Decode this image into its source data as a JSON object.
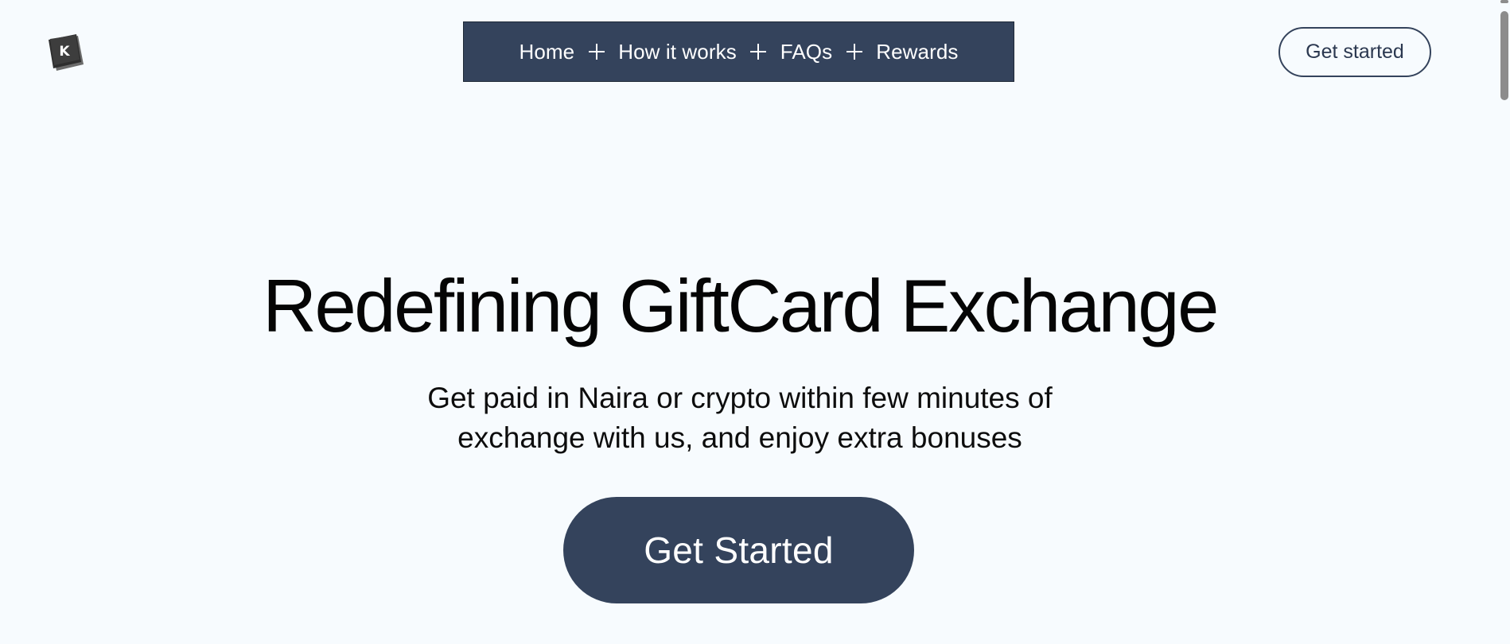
{
  "brand": {
    "logo_letter": "K",
    "logo_color": "#3a3a3a"
  },
  "nav": {
    "items": [
      {
        "label": "Home"
      },
      {
        "label": "How it works"
      },
      {
        "label": "FAQs"
      },
      {
        "label": "Rewards"
      }
    ],
    "separator_icon": "plus-icon",
    "background": "#34435c"
  },
  "header": {
    "cta_label": "Get started"
  },
  "hero": {
    "title": "Redefining GiftCard Exchange",
    "subtitle_line1": "Get paid in Naira or crypto within few minutes of",
    "subtitle_line2": "exchange with us, and enjoy extra bonuses",
    "cta_label": "Get Started"
  },
  "colors": {
    "background": "#f7fbfe",
    "accent": "#34435c",
    "text": "#050505"
  }
}
